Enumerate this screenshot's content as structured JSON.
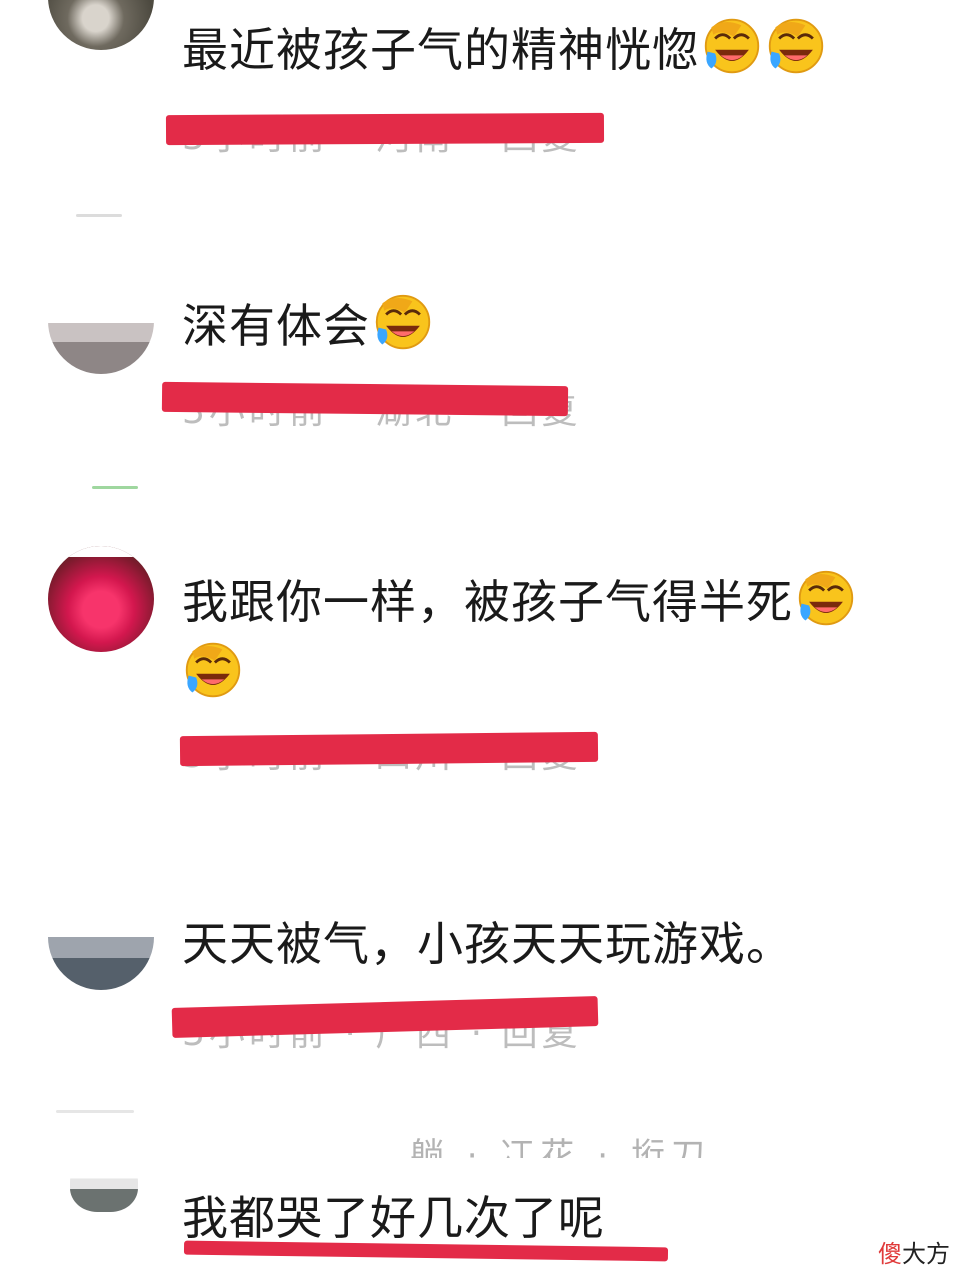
{
  "comments": [
    {
      "text": "最近被孩子气的精神恍惚",
      "emoji_count": 2,
      "emoji": "laughing-crying-emoji",
      "meta": "3小时前 · 河南 · 回复"
    },
    {
      "text": "深有体会",
      "emoji_count": 1,
      "emoji": "laughing-crying-emoji",
      "meta": "3小时前 · 湖北 · 回复"
    },
    {
      "text": "我跟你一样，被孩子气得半死",
      "emoji_count": 2,
      "emoji": "laughing-crying-emoji",
      "meta": "3小时前 · 四川 · 回复"
    },
    {
      "text": "天天被气，小孩天天玩游戏。",
      "emoji_count": 0,
      "meta": "3小时前 · 广西 · 回复"
    },
    {
      "text": "我都哭了好几次了呢",
      "emoji_count": 0,
      "meta": ""
    }
  ],
  "partial_text": "…躺 · 冮花 · 垳刀",
  "watermark": {
    "accent": "傻",
    "rest": "大方"
  },
  "colors": {
    "redaction": "#e32b48",
    "text": "#1a1a1a",
    "meta": "#bdbdbd",
    "emoji_face": "#f9c41c"
  }
}
